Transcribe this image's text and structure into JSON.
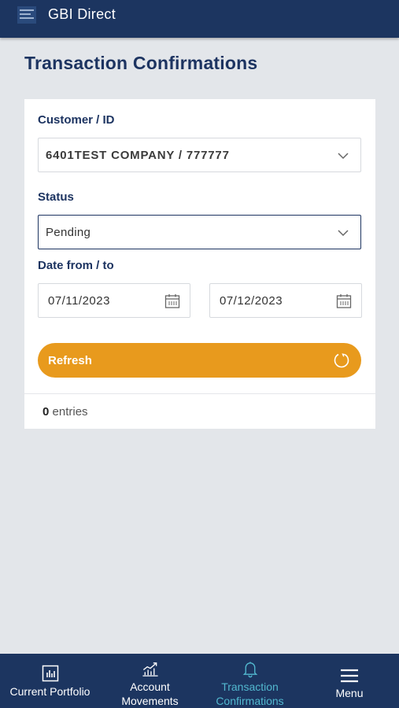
{
  "header": {
    "app_title": "GBI Direct"
  },
  "page": {
    "title": "Transaction Confirmations"
  },
  "form": {
    "customer": {
      "label": "Customer / ID",
      "value": "6401TEST COMPANY / 777777"
    },
    "status": {
      "label": "Status",
      "value": "Pending"
    },
    "date_range": {
      "label": "Date from / to",
      "from": "07/11/2023",
      "to": "07/12/2023"
    },
    "refresh_label": "Refresh"
  },
  "results": {
    "count": "0",
    "suffix": "entries"
  },
  "bottom_nav": {
    "items": [
      {
        "line1": "Current Portfolio",
        "line2": "",
        "icon": "portfolio-chart-icon"
      },
      {
        "line1": "Account",
        "line2": "Movements",
        "icon": "trend-chart-icon"
      },
      {
        "line1": "Transaction",
        "line2": "Confirmations",
        "icon": "bell-icon",
        "active": true
      },
      {
        "line1": "Menu",
        "line2": "",
        "icon": "hamburger-icon"
      }
    ]
  },
  "colors": {
    "primary": "#1c3560",
    "accent": "#e89a1d",
    "active_nav": "#52b8cf",
    "background": "#e3e6ea"
  }
}
